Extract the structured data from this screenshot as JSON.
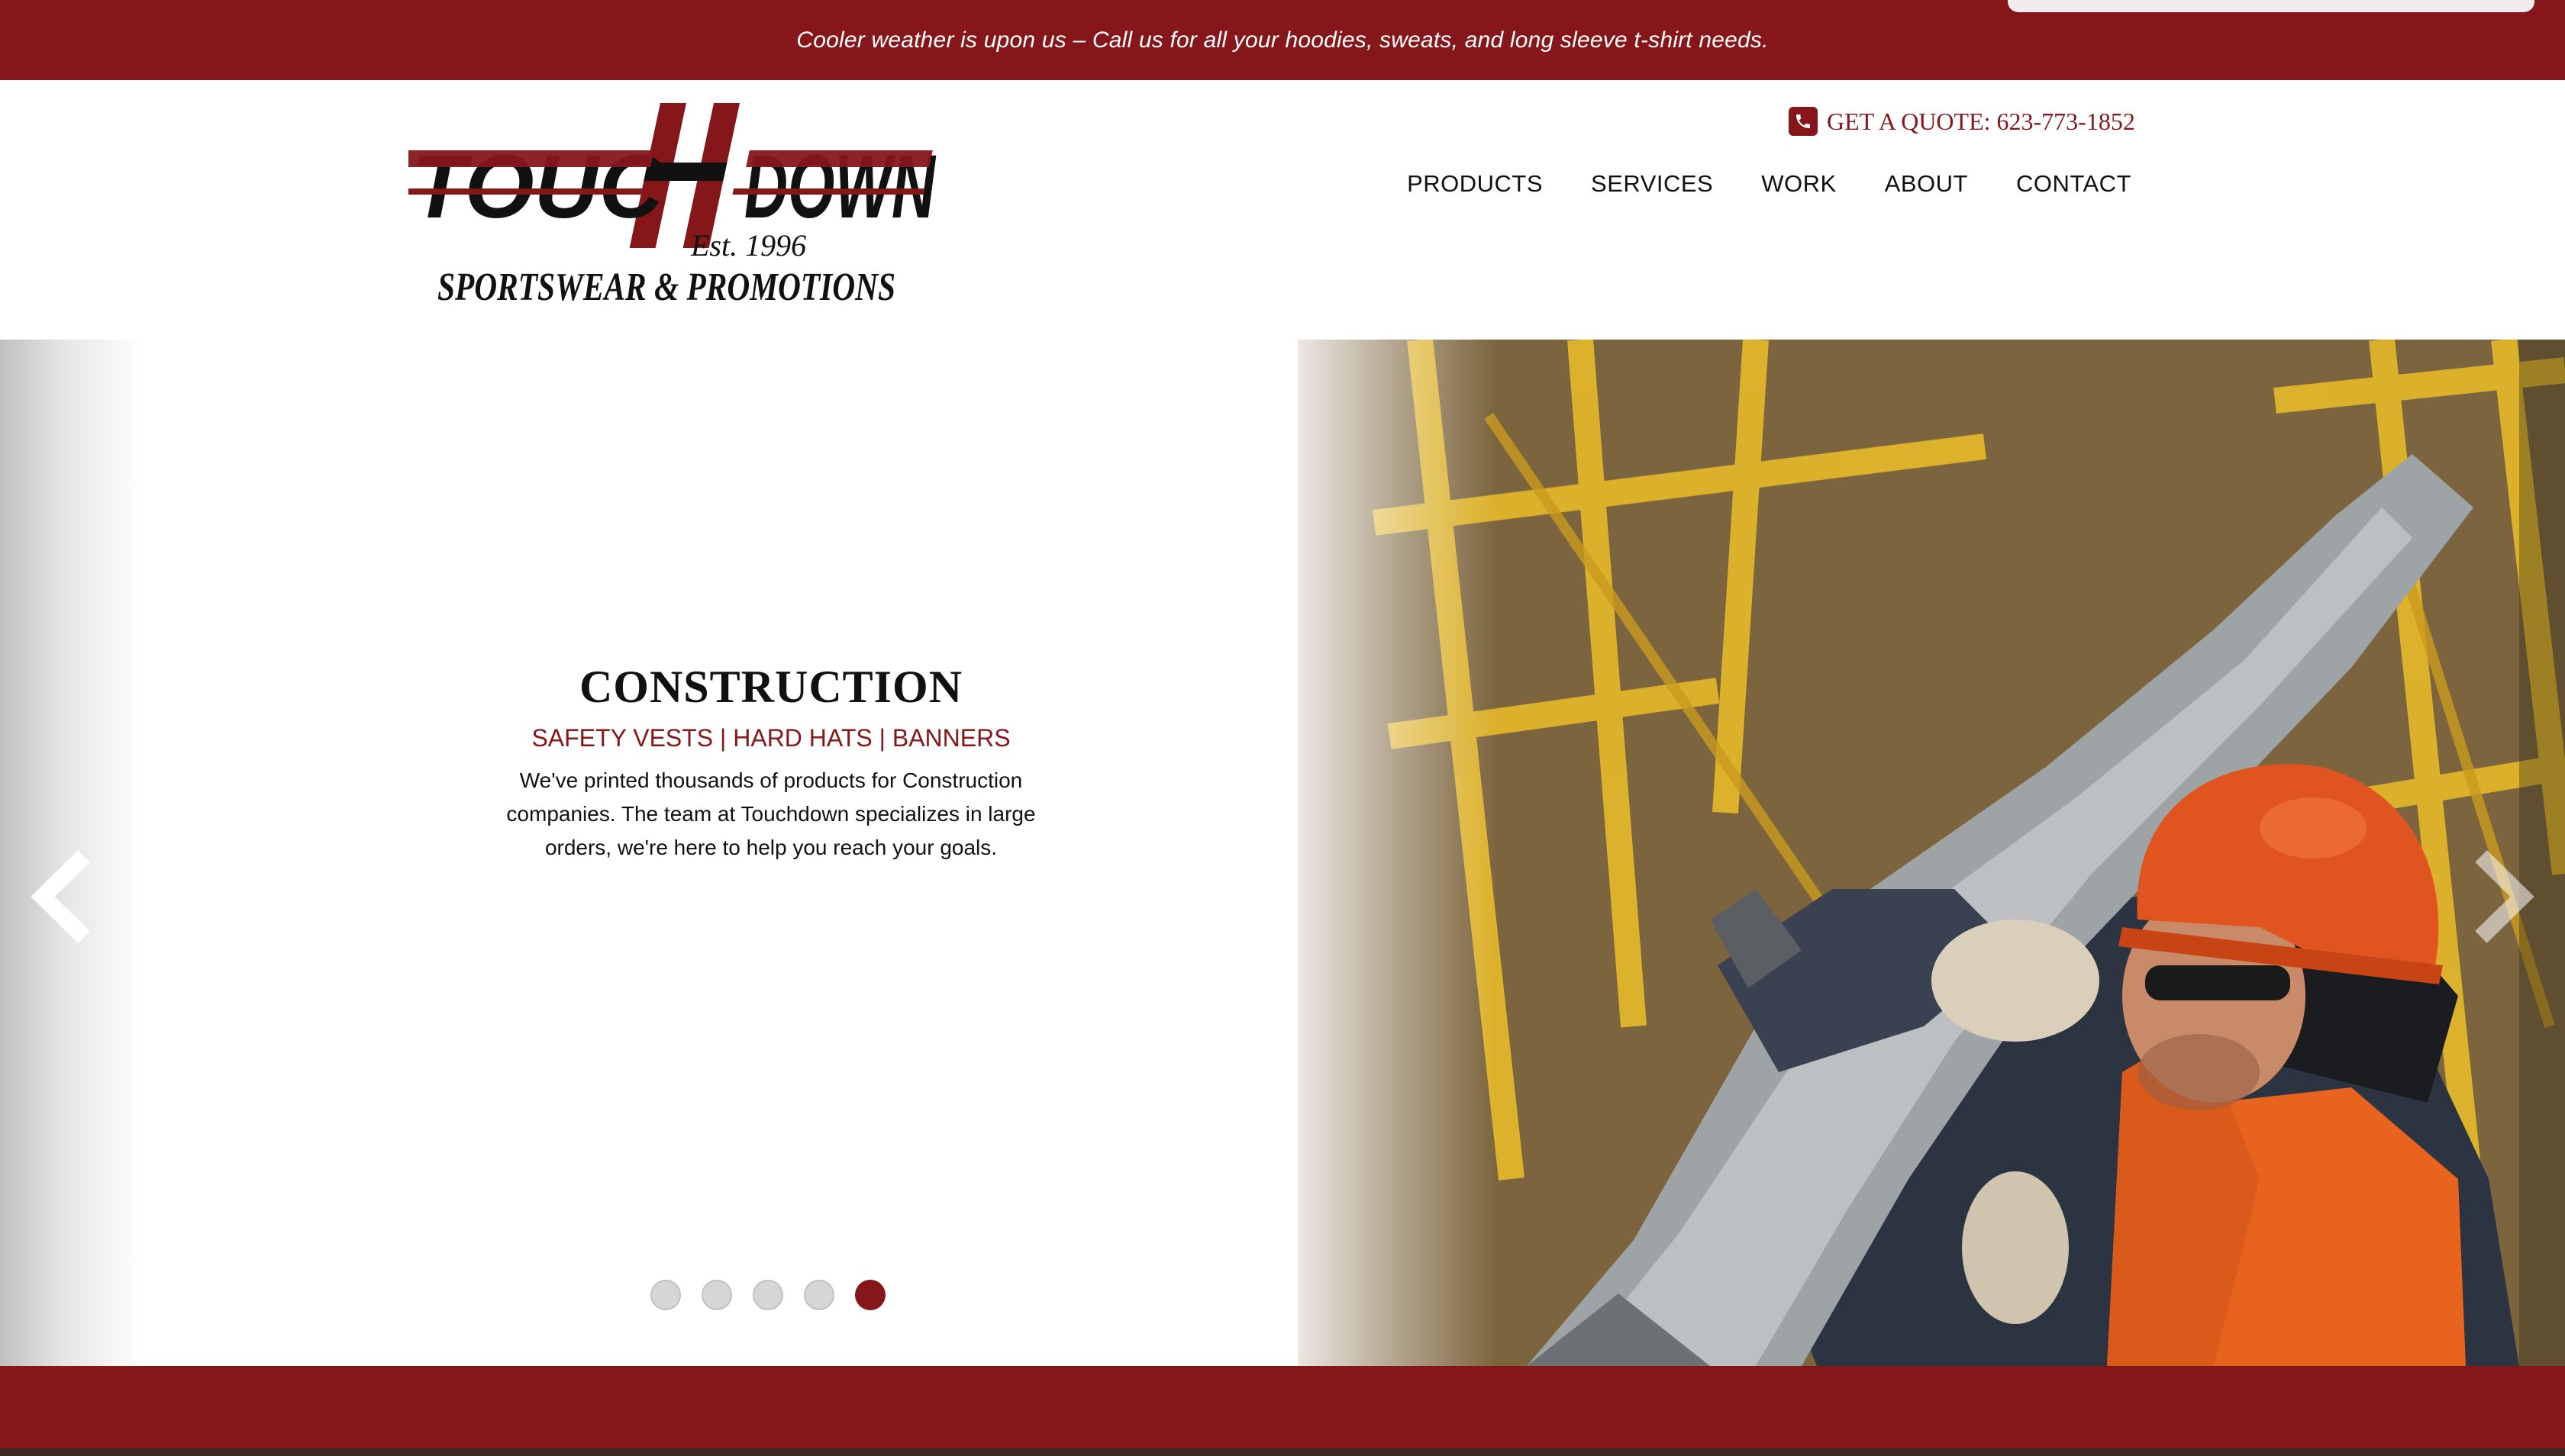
{
  "announcement": {
    "text": "Cooler weather is upon us – Call us for all your hoodies, sweats, and long sleeve t-shirt needs."
  },
  "logo": {
    "wordmark": "TOUCHDOWN",
    "established": "Est. 1996",
    "tagline": "SPORTSWEAR & PROMOTIONS"
  },
  "header": {
    "quote": "GET A QUOTE: 623-773-1852",
    "phone_icon": "phone-icon"
  },
  "nav": {
    "items": [
      {
        "label": "PRODUCTS"
      },
      {
        "label": "SERVICES"
      },
      {
        "label": "WORK"
      },
      {
        "label": "ABOUT"
      },
      {
        "label": "CONTACT"
      }
    ]
  },
  "hero": {
    "title": "CONSTRUCTION",
    "subtitle": "SAFETY VESTS | HARD HATS | BANNERS",
    "body": "We've printed thousands of products for Construction companies. The team at Touchdown specializes in large orders, we're here to help you reach your goals.",
    "slides_total": 5,
    "active_slide": 5,
    "prev_icon": "chevron-left-icon",
    "next_icon": "chevron-right-icon"
  },
  "colors": {
    "brand_red": "#85171b",
    "nav_text": "#111111",
    "dot_inactive": "#d6d6d6"
  }
}
